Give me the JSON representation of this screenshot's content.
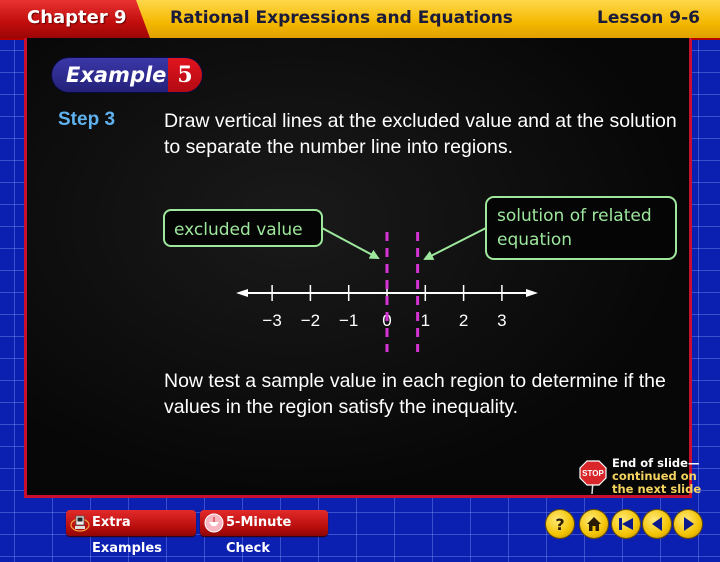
{
  "header": {
    "chapter": "Chapter 9",
    "title": "Rational Expressions and Equations",
    "lesson": "Lesson 9-6"
  },
  "example": {
    "word": "Example",
    "number": "5"
  },
  "step": {
    "label": "Step 3",
    "text": "Draw vertical lines at the excluded value and at the solution to separate the number line into regions."
  },
  "diagram": {
    "callout_left": "excluded value",
    "callout_right_line1": "solution of related",
    "callout_right_line2": "equation",
    "number_line": {
      "ticks": [
        -3,
        -2,
        -1,
        0,
        1,
        2,
        3
      ],
      "tick_labels": [
        "−3",
        "−2",
        "−1",
        "0",
        "1",
        "2",
        "3"
      ],
      "excluded_value": 0,
      "solution_value": 0.8
    },
    "colors": {
      "callout": "#9ee89e",
      "dashed_line": "#d633d6"
    }
  },
  "followup_text": "Now test a sample value in each region to determine if the values in the region satisfy the inequality.",
  "end_of_slide": {
    "line1": "End of slide—",
    "line2": "continued on",
    "line3": "the next slide",
    "icon_text": "STOP"
  },
  "footer": {
    "extra_examples": "Extra Examples",
    "five_minute_check": "5-Minute Check",
    "nav": [
      "help",
      "home",
      "first",
      "previous",
      "next"
    ]
  }
}
